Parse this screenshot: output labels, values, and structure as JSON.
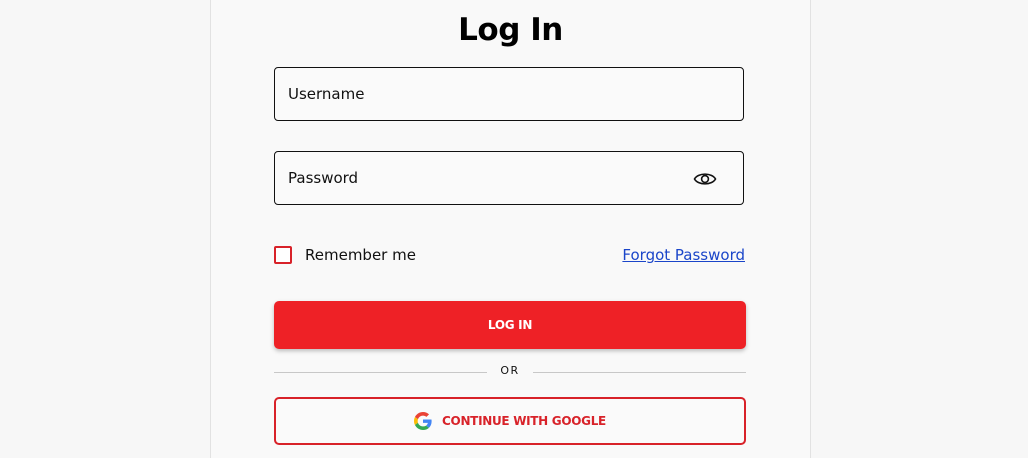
{
  "login": {
    "title": "Log In",
    "username_placeholder": "Username",
    "password_placeholder": "Password",
    "remember_label": "Remember me",
    "forgot_label": "Forgot Password",
    "login_button": "LOG IN",
    "divider_text": "OR",
    "google_button": "CONTINUE WITH GOOGLE"
  },
  "icons": {
    "password_toggle": "eye-icon",
    "google": "google-icon"
  },
  "colors": {
    "accent": "#ee2126",
    "outline_accent": "#d82229",
    "link": "#1a45c9",
    "background": "#f9f9f9"
  }
}
